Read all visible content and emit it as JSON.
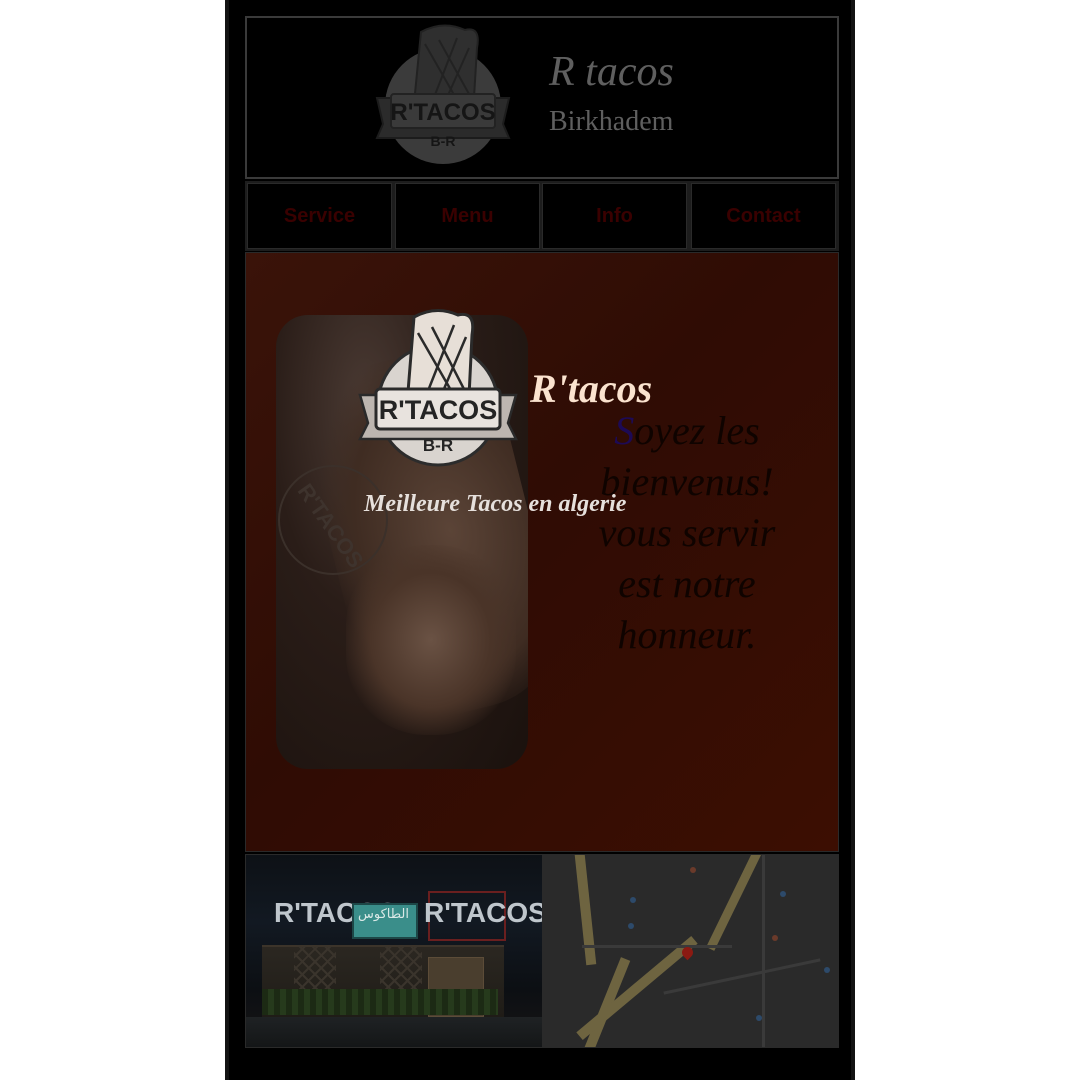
{
  "header": {
    "title": "R tacos",
    "subtitle": "Birkhadem",
    "logo_text": "R'TACOS",
    "logo_sub": "B-R"
  },
  "nav": {
    "items": [
      {
        "label": "Service"
      },
      {
        "label": "Menu"
      },
      {
        "label": "Info"
      },
      {
        "label": "Contact"
      }
    ]
  },
  "hero": {
    "logo_text": "R'TACOS",
    "logo_sub": "B-R",
    "brand": "R'tacos",
    "slogan": "Meilleure Tacos en algerie",
    "welcome_first": "S",
    "welcome_rest_1": "oyez les",
    "welcome_line_2": "bienvenus!",
    "welcome_line_3": "vous servir",
    "welcome_line_4": "est notre",
    "welcome_line_5": "honneur.",
    "photo_stamp_text": "R'TACOS"
  },
  "footer": {
    "sign_left": "R'TACOS",
    "sign_right": "R'TACOS",
    "sign_mid": "الطاكوس"
  },
  "colors": {
    "nav_text": "#3a0000",
    "hero_brand": "#fbe3cf",
    "hero_bg": "#3a1309"
  }
}
